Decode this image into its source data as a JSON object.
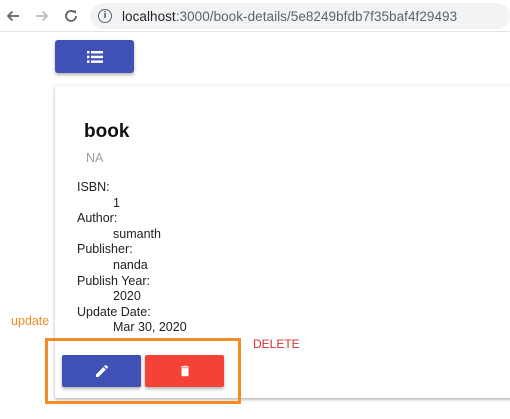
{
  "browser": {
    "url_host": "localhost",
    "url_path": ":3000/book-details/5e8249bfdb7f35baf4f29493"
  },
  "book": {
    "title": "book",
    "subtitle": "NA",
    "fields": [
      {
        "label": "ISBN:",
        "value": "1"
      },
      {
        "label": "Author:",
        "value": "sumanth"
      },
      {
        "label": "Publisher:",
        "value": "nanda"
      },
      {
        "label": "Publish Year:",
        "value": "2020"
      },
      {
        "label": "Update Date:",
        "value": "Mar 30, 2020"
      }
    ]
  },
  "annotations": {
    "update": "update",
    "delete": "DELETE"
  },
  "colors": {
    "primary": "#3f51b5",
    "danger": "#f44336",
    "annotation_box": "#f28c28",
    "annotation_delete_text": "#d32f2f"
  },
  "icons": {
    "menu": "list-icon",
    "edit": "pencil-icon",
    "delete": "trash-icon"
  }
}
